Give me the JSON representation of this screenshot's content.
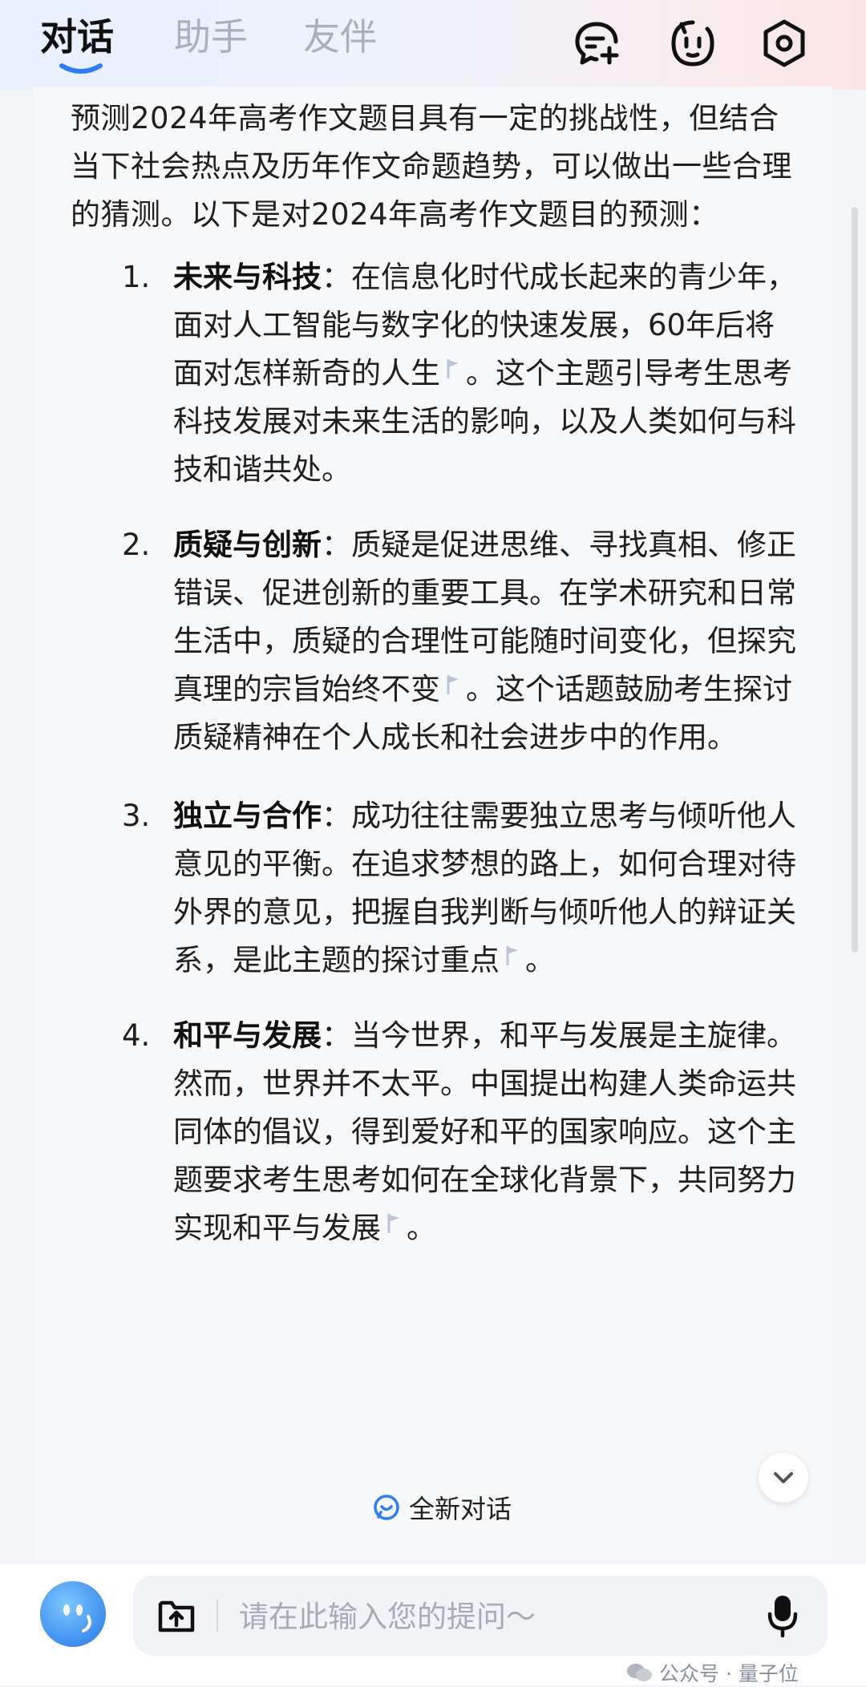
{
  "header": {
    "tabs": [
      {
        "label": "对话",
        "active": true
      },
      {
        "label": "助手",
        "active": false
      },
      {
        "label": "友伴",
        "active": false
      }
    ],
    "icons": [
      "new-chat-icon",
      "assistant-face-icon",
      "settings-icon"
    ]
  },
  "message": {
    "intro": "预测2024年高考作文题目具有一定的挑战性，但结合当下社会热点及历年作文命题趋势，可以做出一些合理的猜测。以下是对2024年高考作文题目的预测：",
    "items": [
      {
        "num": "1.",
        "title": "未来与科技",
        "sep": "：",
        "text_a": "在信息化时代成长起来的青少年，面对人工智能与数字化的快速发展，60年后将面对怎样新奇的人生",
        "text_b": "。这个主题引导考生思考科技发展对未来生活的影响，以及人类如何与科技和谐共处。"
      },
      {
        "num": "2.",
        "title": "质疑与创新",
        "sep": "：",
        "text_a": "质疑是促进思维、寻找真相、修正错误、促进创新的重要工具。在学术研究和日常生活中，质疑的合理性可能随时间变化，但探究真理的宗旨始终不变",
        "text_b": "。这个话题鼓励考生探讨质疑精神在个人成长和社会进步中的作用。"
      },
      {
        "num": "3.",
        "title": "独立与合作",
        "sep": "：",
        "text_a": "成功往往需要独立思考与倾听他人意见的平衡。在追求梦想的路上，如何合理对待外界的意见，把握自我判断与倾听他人的辩证关系，是此主题的探讨重点",
        "text_b": "。"
      },
      {
        "num": "4.",
        "title": "和平与发展",
        "sep": "：",
        "text_a": "当今世界，和平与发展是主旋律。然而，世界并不太平。中国提出构建人类命运共同体的倡议，得到爱好和平的国家响应。这个主题要求考生思考如何在全球化背景下，共同努力实现和平与发展",
        "text_b": "。"
      }
    ]
  },
  "floating": {
    "new_chat_label": "全新对话"
  },
  "input": {
    "placeholder": "请在此输入您的提问～"
  },
  "watermark": {
    "text": "公众号 · 量子位"
  },
  "colors": {
    "accent": "#2f7cf6",
    "muted_tab": "#a9b0bd",
    "citation": "#b9c4d6"
  }
}
